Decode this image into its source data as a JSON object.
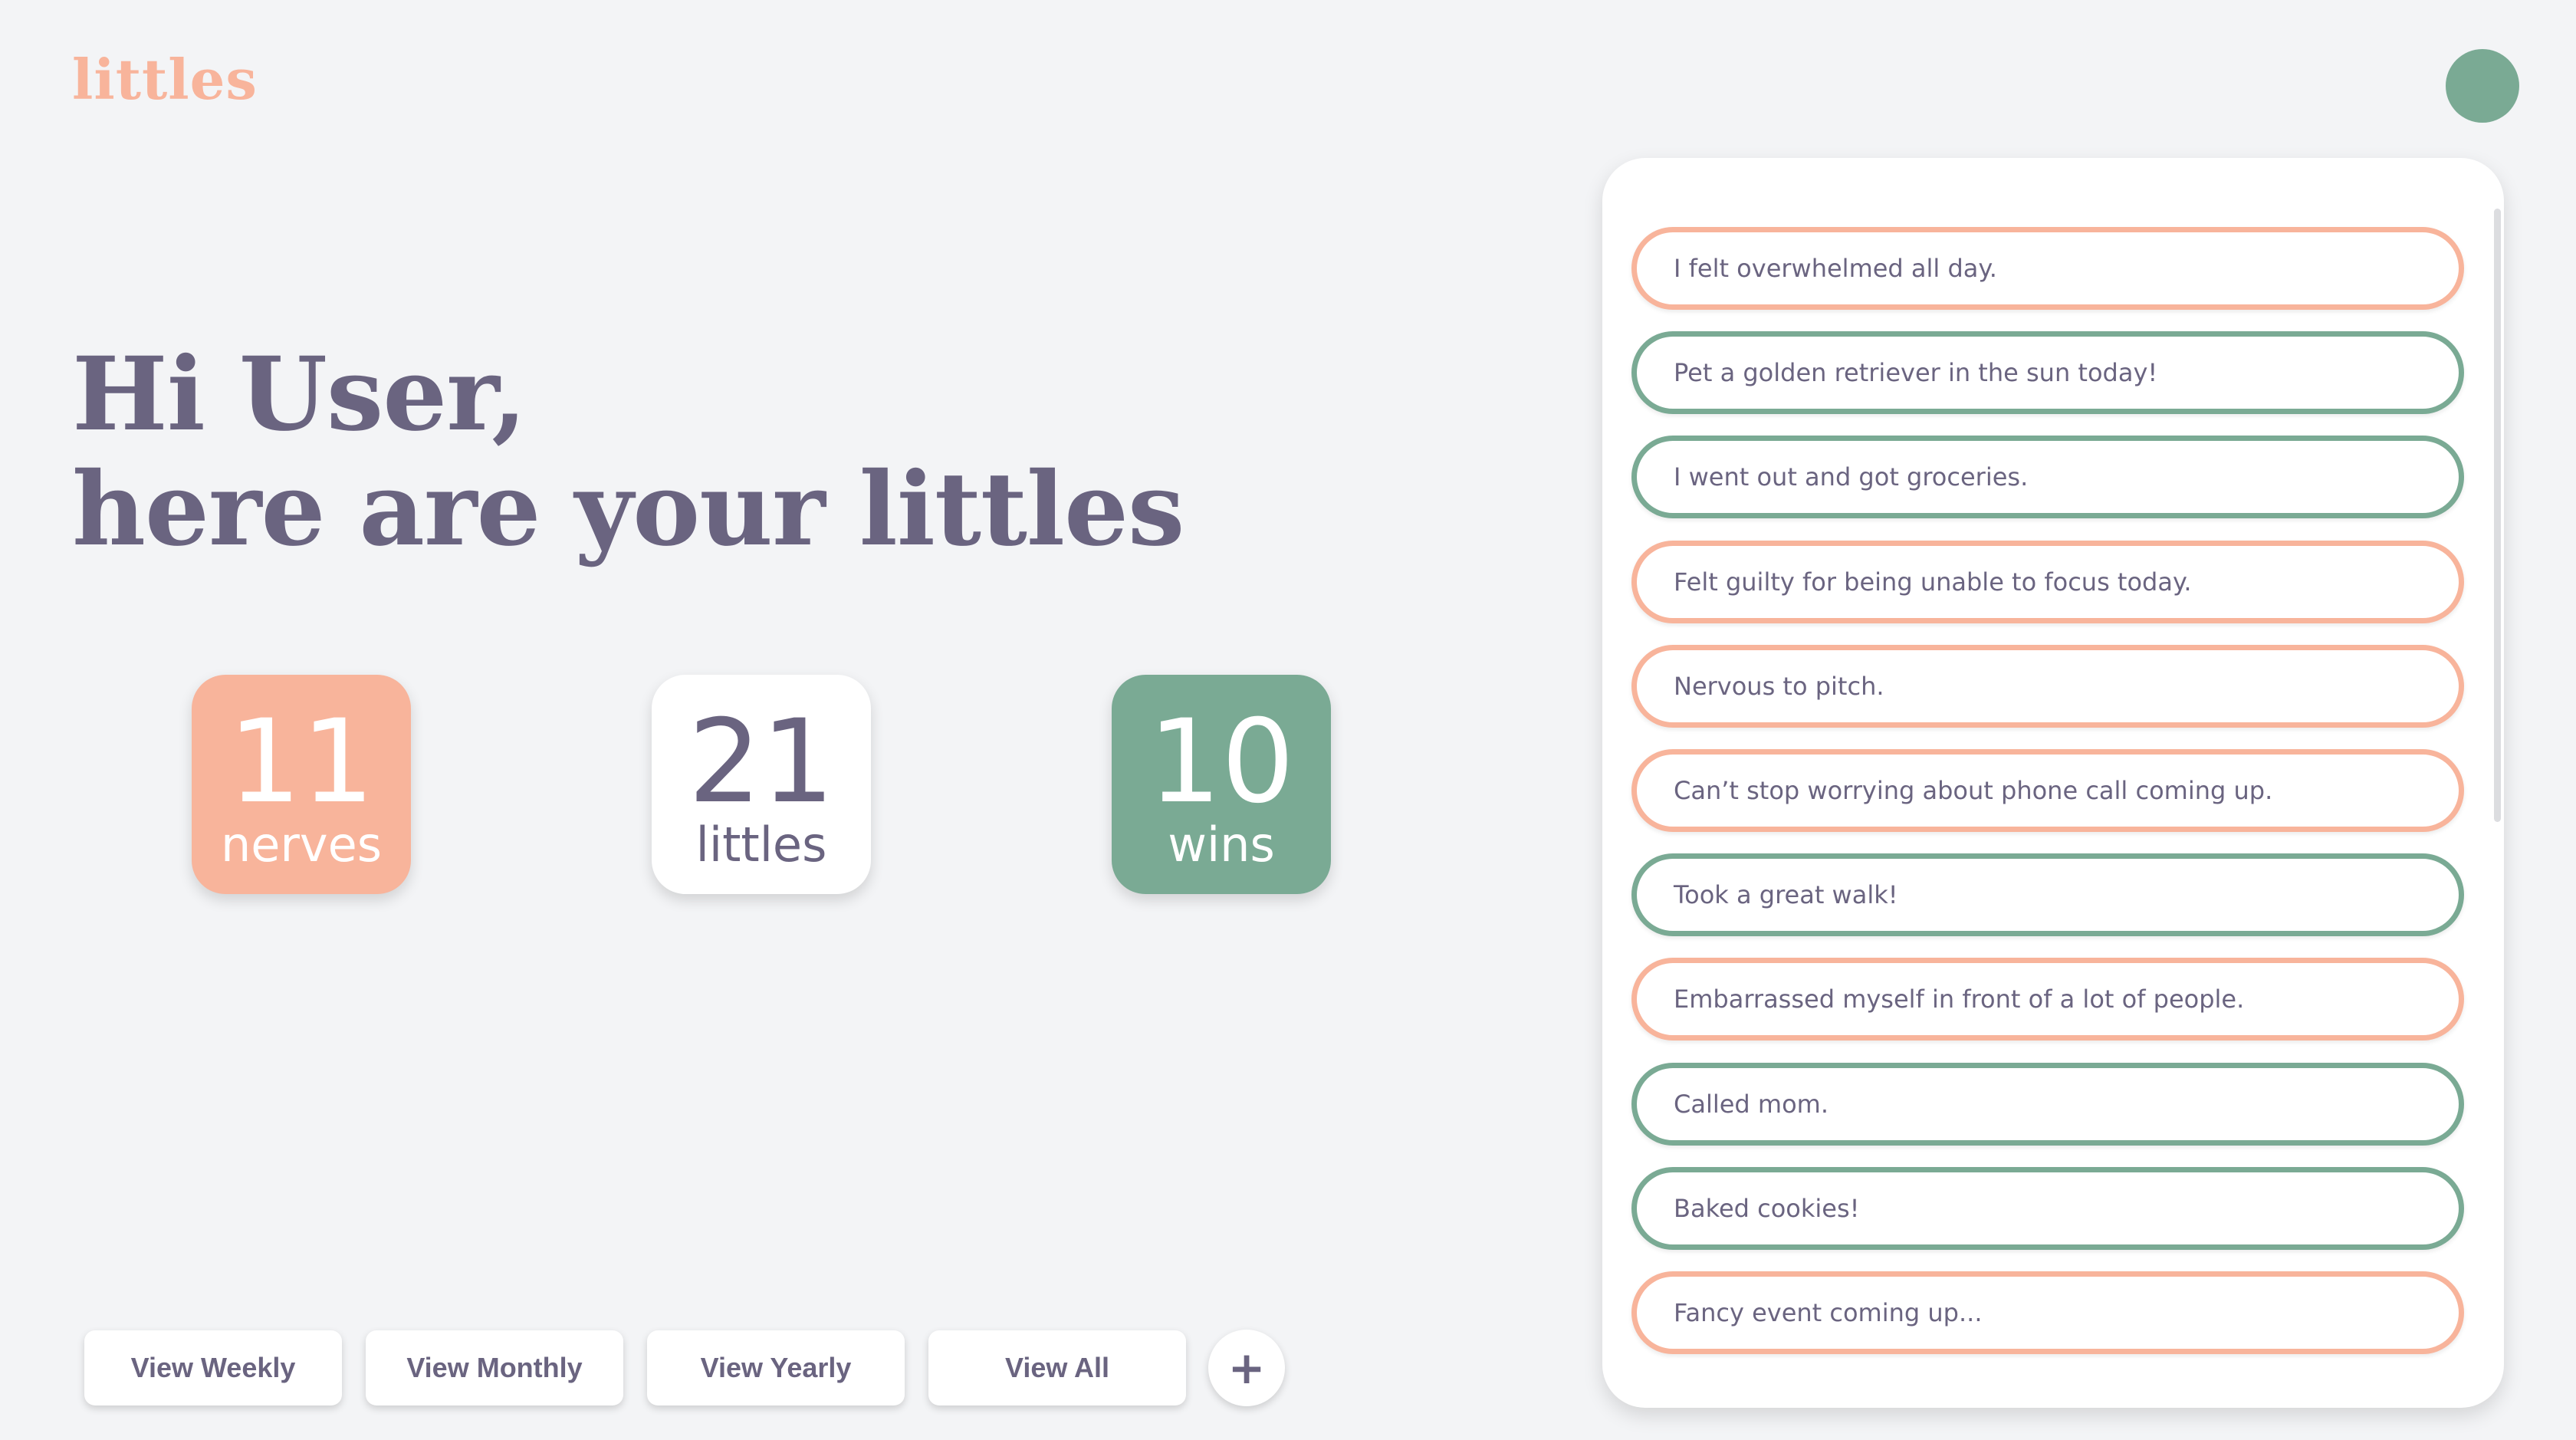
{
  "app": {
    "logo_text": "littles"
  },
  "colors": {
    "nerve": "#f8b49b",
    "win": "#7aaa94",
    "text": "#6a6480",
    "background": "#f3f4f6",
    "panel": "#ffffff"
  },
  "header": {
    "avatar_icon": "user-avatar-circle"
  },
  "greeting": {
    "line1": "Hi User,",
    "line2": "here are your littles"
  },
  "stats": {
    "nerves": {
      "value": "11",
      "label": "nerves"
    },
    "littles": {
      "value": "21",
      "label": "littles"
    },
    "wins": {
      "value": "10",
      "label": "wins"
    }
  },
  "view_buttons": {
    "weekly": "View Weekly",
    "monthly": "View Monthly",
    "yearly": "View Yearly",
    "all": "View All",
    "add": "+"
  },
  "entries": [
    {
      "text": "I felt overwhelmed all day.",
      "type": "nerve"
    },
    {
      "text": "Pet a golden retriever in the sun today!",
      "type": "win"
    },
    {
      "text": "I went out and got groceries.",
      "type": "win"
    },
    {
      "text": "Felt guilty for being unable to focus today.",
      "type": "nerve"
    },
    {
      "text": "Nervous to pitch.",
      "type": "nerve"
    },
    {
      "text": "Can’t stop worrying about phone call coming up.",
      "type": "nerve"
    },
    {
      "text": "Took a great walk!",
      "type": "win"
    },
    {
      "text": "Embarrassed myself in front of a lot of people.",
      "type": "nerve"
    },
    {
      "text": "Called mom.",
      "type": "win"
    },
    {
      "text": "Baked cookies!",
      "type": "win"
    },
    {
      "text": "Fancy event coming up...",
      "type": "nerve"
    }
  ]
}
